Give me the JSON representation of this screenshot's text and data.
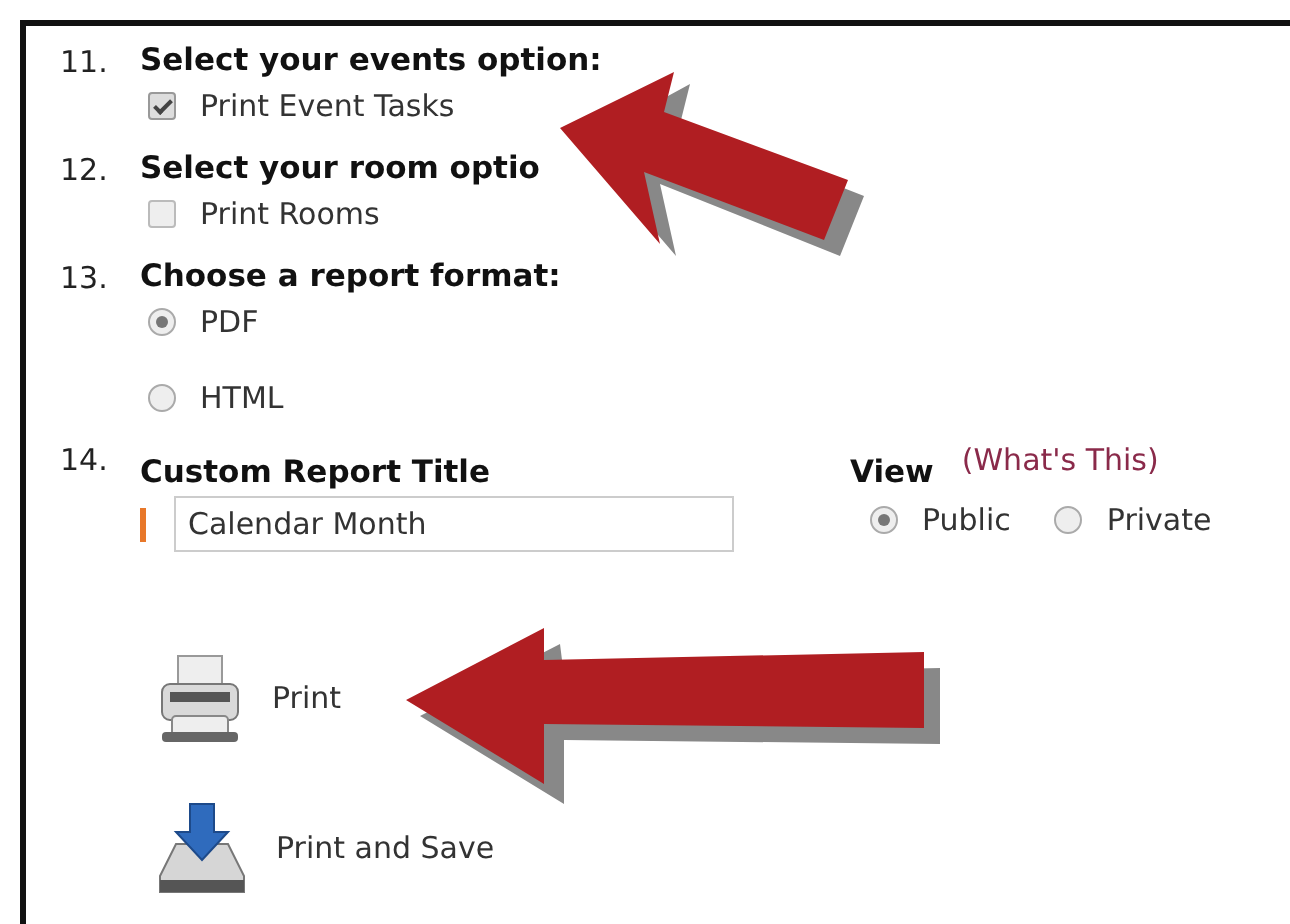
{
  "steps": [
    {
      "number": "11.",
      "heading": "Select your events option:",
      "options": [
        {
          "kind": "checkbox",
          "label": "Print Event Tasks",
          "checked": true
        }
      ]
    },
    {
      "number": "12.",
      "heading": "Select your room optio",
      "options": [
        {
          "kind": "checkbox",
          "label": "Print Rooms",
          "checked": false
        }
      ]
    },
    {
      "number": "13.",
      "heading": "Choose a report format:",
      "options": [
        {
          "kind": "radio",
          "label": "PDF",
          "selected": true
        },
        {
          "kind": "radio",
          "label": "HTML",
          "selected": false
        }
      ]
    }
  ],
  "custom_title": {
    "number": "14.",
    "heading": "Custom Report Title",
    "value": "Calendar Month"
  },
  "view": {
    "heading": "View",
    "help_link": "(What's This)",
    "options": [
      {
        "label": "Public",
        "selected": true
      },
      {
        "label": "Private",
        "selected": false
      }
    ]
  },
  "actions": [
    {
      "kind": "print",
      "label": "Print"
    },
    {
      "kind": "save",
      "label": "Print and Save"
    }
  ]
}
